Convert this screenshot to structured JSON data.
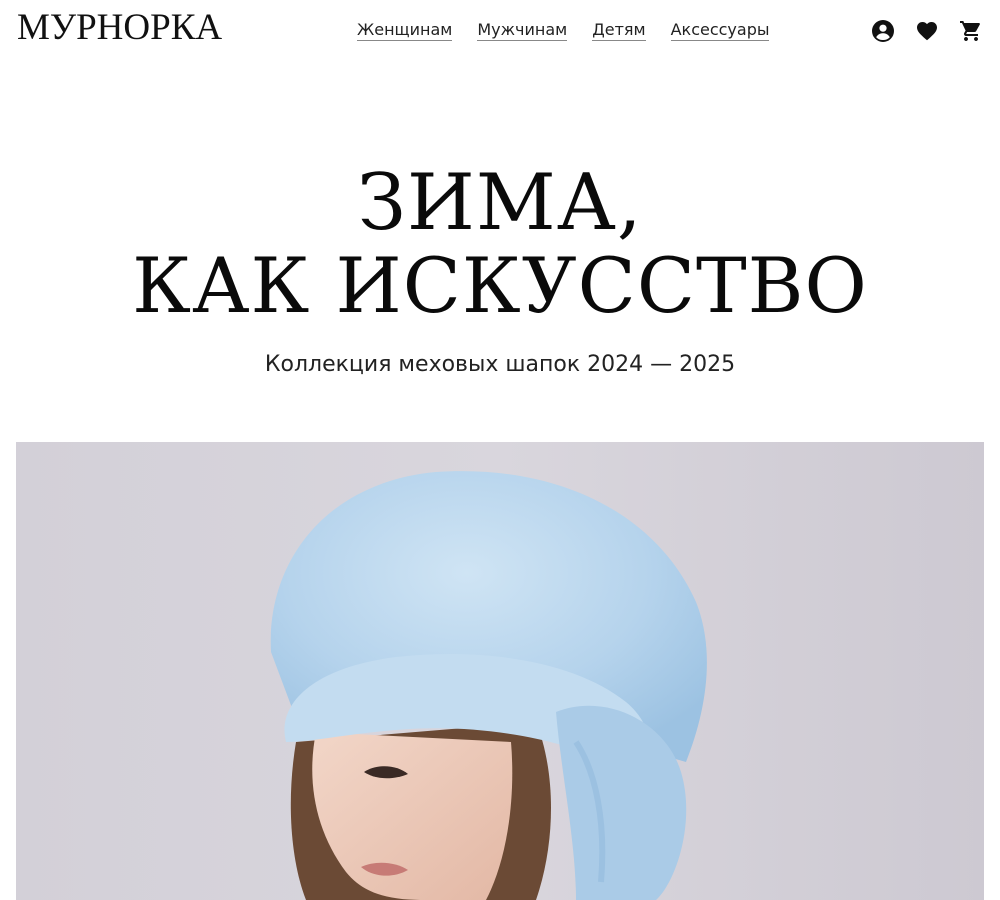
{
  "header": {
    "logo": "МУРНОРКА",
    "nav": [
      {
        "label": "Женщинам"
      },
      {
        "label": "Мужчинам"
      },
      {
        "label": "Детям"
      },
      {
        "label": "Аксессуары"
      }
    ],
    "icons": [
      "account-icon",
      "heart-icon",
      "cart-icon"
    ]
  },
  "hero": {
    "title_line1": "ЗИМА,",
    "title_line2": "КАК ИСКУССТВО",
    "subtitle": "Коллекция меховых шапок 2024 — 2025"
  },
  "colors": {
    "background": "#ffffff",
    "text": "#111111",
    "photo_backdrop": "#d6d3da",
    "hat": "#b9d6ec"
  }
}
